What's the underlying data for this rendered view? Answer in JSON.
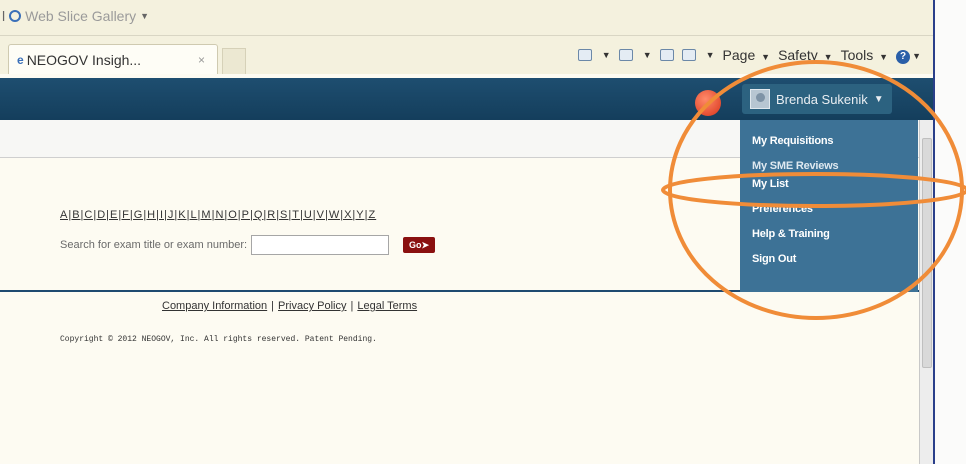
{
  "browser": {
    "favorites_item": "Web Slice Gallery",
    "tab_title": "NEOGOV Insigh...",
    "tab_close": "×",
    "commands": {
      "page_label": "Page",
      "safety_label": "Safety",
      "tools_label": "Tools",
      "help_glyph": "?"
    }
  },
  "header": {
    "user_name": "Brenda Sukenik"
  },
  "user_menu": {
    "items": [
      "My Requisitions",
      "My SME Reviews",
      "My List",
      "Preferences",
      "Help & Training",
      "Sign Out"
    ]
  },
  "main": {
    "alphabet_index": "A|B|C|D|E|F|G|H|I|J|K|L|M|N|O|P|Q|R|S|T|U|V|W|X|Y|Z",
    "search_label": "Search for exam title or exam number:",
    "search_value": "",
    "go_label": "Go"
  },
  "footer": {
    "company_info": "Company Information",
    "privacy": "Privacy Policy",
    "legal": "Legal Terms",
    "separator": "|",
    "copyright": "Copyright © 2012 NEOGOV, Inc. All rights reserved. Patent Pending."
  },
  "colors": {
    "header_bg": "#1a4666",
    "menu_bg": "#3d7296",
    "annotation": "#f08c38",
    "go_button": "#8a1010"
  },
  "icons": {
    "favorites": "ie-icon",
    "home": "home-icon",
    "feeds": "feeds-icon",
    "mail": "mail-icon",
    "print": "print-icon",
    "help": "help-icon",
    "notification": "notification-icon",
    "avatar": "avatar-icon",
    "caret": "chevron-down-icon"
  }
}
